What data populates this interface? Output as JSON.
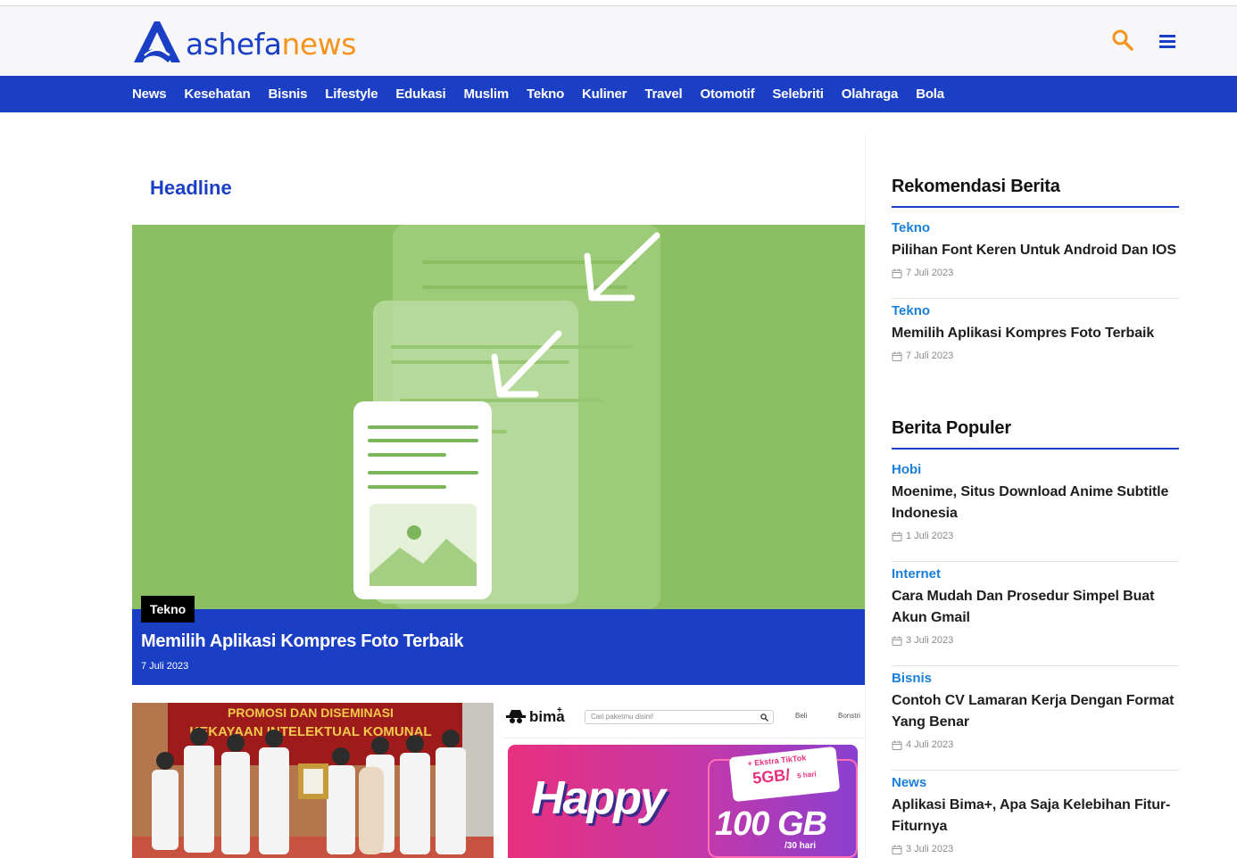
{
  "brand": {
    "name_part1": "ashefa",
    "name_part2": "news",
    "primary_color": "#1a3fc4",
    "accent_color": "#f2941f"
  },
  "header": {
    "search_icon": "search-icon",
    "menu_icon": "hamburger-menu-icon"
  },
  "nav": {
    "items": [
      "News",
      "Kesehatan",
      "Bisnis",
      "Lifestyle",
      "Edukasi",
      "Muslim",
      "Tekno",
      "Kuliner",
      "Travel",
      "Otomotif",
      "Selebriti",
      "Olahraga",
      "Bola"
    ]
  },
  "main": {
    "section_title": "Headline",
    "hero": {
      "category": "Tekno",
      "title": "Memilih Aplikasi Kompres Foto Terbaik",
      "date": "7 Juli 2023"
    },
    "card1": {
      "banner_line1": "PROMOSI DAN DISEMINASI",
      "banner_line2": "KEKAYAAN INTELEKTUAL KOMUNAL"
    },
    "card2": {
      "app_name": "bima",
      "search_placeholder": "Cari paketmu disini!",
      "link_beli": "Beli",
      "link_bonstri": "Bonstri",
      "promo_word": "Happy",
      "promo_extra": "+ Ekstra TikTok",
      "promo_bonus": "5GB/",
      "promo_bonus_unit": "5 hari",
      "promo_quota": "100 GB",
      "promo_quota_unit": "/30 hari"
    }
  },
  "sidebar": {
    "recommend": {
      "title": "Rekomendasi Berita",
      "items": [
        {
          "category": "Tekno",
          "title": "Pilihan Font Keren Untuk Android Dan IOS",
          "date": "7 Juli 2023"
        },
        {
          "category": "Tekno",
          "title": "Memilih Aplikasi Kompres Foto Terbaik",
          "date": "7 Juli 2023"
        }
      ]
    },
    "popular": {
      "title": "Berita Populer",
      "items": [
        {
          "category": "Hobi",
          "title": "Moenime, Situs Download Anime Subtitle Indonesia",
          "date": "1 Juli 2023"
        },
        {
          "category": "Internet",
          "title": "Cara Mudah Dan Prosedur Simpel Buat Akun Gmail",
          "date": "3 Juli 2023"
        },
        {
          "category": "Bisnis",
          "title": "Contoh CV Lamaran Kerja Dengan Format Yang Benar",
          "date": "4 Juli 2023"
        },
        {
          "category": "News",
          "title": "Aplikasi Bima+, Apa Saja Kelebihan Fitur-Fiturnya",
          "date": "3 Juli 2023"
        }
      ]
    }
  }
}
